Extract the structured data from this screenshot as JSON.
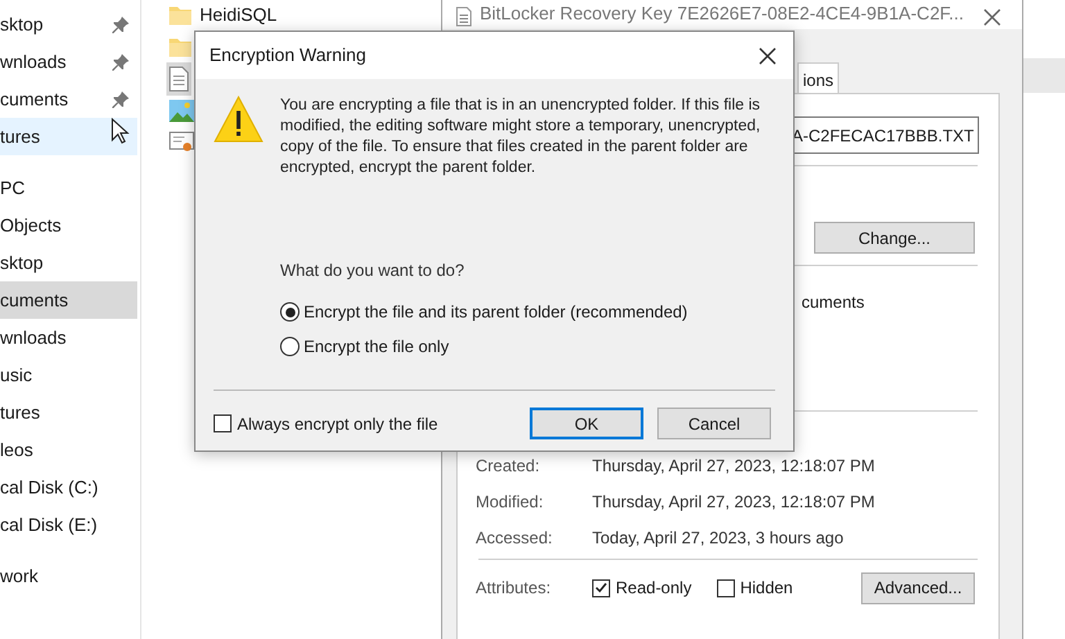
{
  "explorer": {
    "nav_groups": [
      {
        "items": [
          {
            "label": "sktop",
            "pinned": true,
            "selected": false,
            "hovered": false
          },
          {
            "label": "wnloads",
            "pinned": true,
            "selected": false,
            "hovered": false
          },
          {
            "label": "cuments",
            "pinned": true,
            "selected": false,
            "hovered": false
          },
          {
            "label": "tures",
            "pinned": false,
            "selected": false,
            "hovered": true
          }
        ]
      },
      {
        "items": [
          {
            "label": "PC",
            "pinned": false,
            "selected": false,
            "hovered": false
          },
          {
            "label": "Objects",
            "pinned": false,
            "selected": false,
            "hovered": false
          },
          {
            "label": "sktop",
            "pinned": false,
            "selected": false,
            "hovered": false
          },
          {
            "label": "cuments",
            "pinned": false,
            "selected": true,
            "hovered": false
          },
          {
            "label": "wnloads",
            "pinned": false,
            "selected": false,
            "hovered": false
          },
          {
            "label": "usic",
            "pinned": false,
            "selected": false,
            "hovered": false
          },
          {
            "label": "tures",
            "pinned": false,
            "selected": false,
            "hovered": false
          },
          {
            "label": "leos",
            "pinned": false,
            "selected": false,
            "hovered": false
          },
          {
            "label": "cal Disk (C:)",
            "pinned": false,
            "selected": false,
            "hovered": false
          },
          {
            "label": "cal Disk (E:)",
            "pinned": false,
            "selected": false,
            "hovered": false
          }
        ]
      },
      {
        "items": [
          {
            "label": "work",
            "pinned": false,
            "selected": false,
            "hovered": false
          }
        ]
      }
    ],
    "files": [
      {
        "kind": "folder",
        "name": "HeidiSQL",
        "selected": false
      },
      {
        "kind": "folder",
        "selected": false
      },
      {
        "kind": "text",
        "selected": true
      },
      {
        "kind": "image",
        "selected": false
      },
      {
        "kind": "certificate",
        "selected": false
      }
    ]
  },
  "properties": {
    "title": "BitLocker Recovery Key 7E2626E7-08E2-4CE4-9B1A-C2F...",
    "tab": {
      "label": "ions",
      "selected": true
    },
    "filename": "A-C2FECAC17BBB.TXT",
    "change_button": "Change...",
    "location_value": "cuments",
    "dates": [
      {
        "label": "Created:",
        "value": "Thursday, April 27, 2023, 12:18:07 PM"
      },
      {
        "label": "Modified:",
        "value": "Thursday, April 27, 2023, 12:18:07 PM"
      },
      {
        "label": "Accessed:",
        "value": "Today, April 27, 2023, 3 hours ago"
      }
    ],
    "attributes": {
      "label": "Attributes:",
      "options": [
        {
          "label": "Read-only",
          "checked": true
        },
        {
          "label": "Hidden",
          "checked": false
        }
      ]
    },
    "advanced_button": "Advanced..."
  },
  "dialog": {
    "title": "Encryption Warning",
    "message": "You are encrypting a file that is in an unencrypted folder. If this file is modified, the editing software might store a temporary, unencrypted, copy of the file. To ensure that files created in the parent folder are encrypted, encrypt the parent folder.",
    "question": "What do you want to do?",
    "options": [
      {
        "label": "Encrypt the file and its parent folder (recommended)",
        "selected": true
      },
      {
        "label": "Encrypt the file only",
        "selected": false
      }
    ],
    "always_checkbox": {
      "label": "Always encrypt only the file",
      "checked": false
    },
    "buttons": [
      {
        "label": "OK",
        "default": true
      },
      {
        "label": "Cancel",
        "default": false
      }
    ]
  }
}
